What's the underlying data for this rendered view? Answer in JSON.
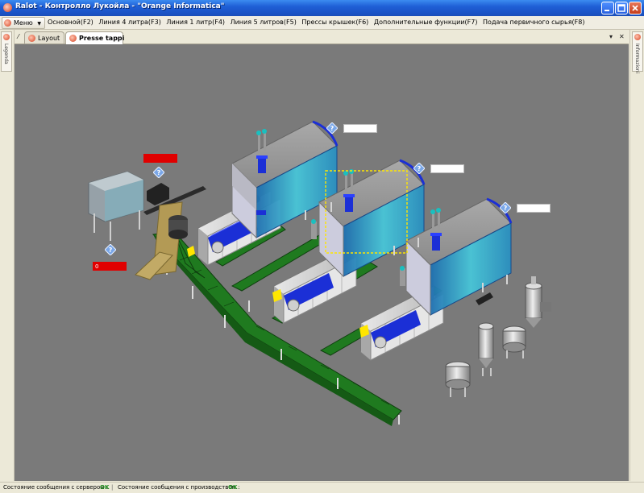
{
  "window": {
    "title": "Ralot - Контролло Лукойла - \"Orange Informatica\"",
    "controls": [
      "minimize",
      "maximize",
      "close"
    ]
  },
  "menubar": {
    "root_label": "Меню",
    "items": [
      "Основной(F2)",
      "Линия 4 литра(F3)",
      "Линия 1 литр(F4)",
      "Линия 5 литров(F5)",
      "Прессы крышек(F6)",
      "Дополнительные функции(F7)",
      "Подача первичного сырья(F8)"
    ]
  },
  "side_panels": {
    "left_label": "Legenda",
    "right_label": "Informazioni"
  },
  "tabs": [
    {
      "label": "Layout",
      "active": false
    },
    {
      "label": "Presse tappi",
      "active": true
    }
  ],
  "canvas": {
    "background": "#7a7a7a",
    "alarm_color": "#e00000",
    "info_color": "#ffffff",
    "conveyor_color": "#1f7a1f",
    "press_accent": "#1b2fd6",
    "help_icon": "question-icon",
    "labels": {
      "top_left_alarm": "",
      "left_alarm": "0",
      "press1_info": "",
      "press2_info": "",
      "press3_info": ""
    }
  },
  "statusbar": {
    "server_label": "Состояние сообщения с сервером :",
    "server_value": "OK",
    "production_label": "Состояние сообщения с производством :",
    "production_value": "OK"
  }
}
